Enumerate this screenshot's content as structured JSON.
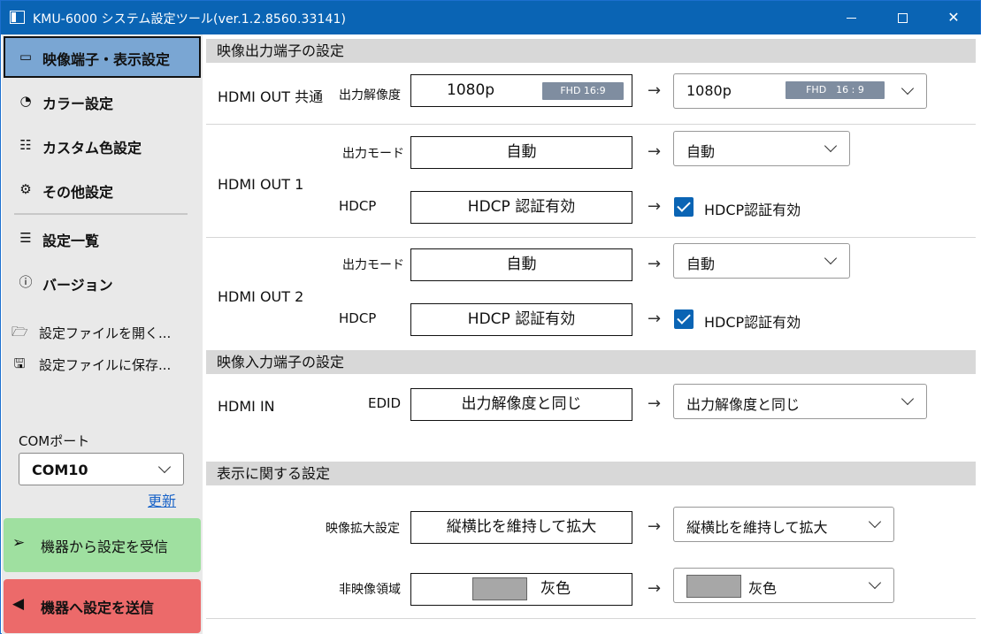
{
  "window": {
    "title": "KMU-6000 システム設定ツール(ver.1.2.8560.33141)",
    "minimize_glyph": "",
    "close_glyph": "✕"
  },
  "sidebar": {
    "nav_items": [
      {
        "label": "映像端子・表示設定",
        "icon": "monitor-icon",
        "glyph": "▭",
        "active": true
      },
      {
        "label": "カラー設定",
        "icon": "palette-icon",
        "glyph": "◔"
      },
      {
        "label": "カスタム色設定",
        "icon": "custom-color-icon",
        "glyph": "☷"
      },
      {
        "label": "その他設定",
        "icon": "gear-icon",
        "glyph": "⚙"
      },
      {
        "label": "設定一覧",
        "icon": "list-icon",
        "glyph": "☰"
      },
      {
        "label": "バージョン",
        "icon": "info-icon",
        "glyph": "ⓘ"
      }
    ],
    "file_items": [
      {
        "label": "設定ファイルを開く...",
        "icon": "folder-open-icon",
        "glyph": "🗁"
      },
      {
        "label": "設定ファイルに保存...",
        "icon": "save-icon",
        "glyph": "🖫"
      }
    ],
    "com": {
      "label": "COMポート",
      "value": "COM10",
      "refresh_label": "更新"
    },
    "receive_label": "機器から設定を受信",
    "receive_glyph": "➢",
    "send_label": "機器へ設定を送信",
    "send_glyph": "◀"
  },
  "sections": {
    "output": {
      "header": "映像出力端子の設定",
      "common": {
        "row_label": "HDMI OUT 共通",
        "field_label": "出力解像度",
        "current": "1080p",
        "current_badge": "FHD 16:9",
        "selected": "1080p",
        "selected_badge": "FHD　16 : 9"
      },
      "out1": {
        "row_label": "HDMI OUT 1",
        "mode_label": "出力モード",
        "mode_current": "自動",
        "mode_selected": "自動",
        "hdcp_label": "HDCP",
        "hdcp_current": "HDCP 認証有効",
        "hdcp_check_label": "HDCP認証有効"
      },
      "out2": {
        "row_label": "HDMI OUT 2",
        "mode_label": "出力モード",
        "mode_current": "自動",
        "mode_selected": "自動",
        "hdcp_label": "HDCP",
        "hdcp_current": "HDCP 認証有効",
        "hdcp_check_label": "HDCP認証有効"
      }
    },
    "input": {
      "header": "映像入力端子の設定",
      "row_label": "HDMI IN",
      "field_label": "EDID",
      "current": "出力解像度と同じ",
      "selected": "出力解像度と同じ"
    },
    "display": {
      "header": "表示に関する設定",
      "zoom_label": "映像拡大設定",
      "zoom_current": "縦横比を維持して拡大",
      "zoom_selected": "縦横比を維持して拡大",
      "nonvideo_label": "非映像領域",
      "nonvideo_current": "灰色",
      "nonvideo_selected": "灰色",
      "swatch_color": "#a7a7a7"
    }
  },
  "arrow_glyph": "→",
  "colors": {
    "titlebar": "#0a64b4",
    "nav_active": "#7aa6d3",
    "receive_button": "#9fe0a0",
    "send_button": "#ec6a6a",
    "checkbox": "#0a64b4",
    "link": "#1a64c8"
  }
}
